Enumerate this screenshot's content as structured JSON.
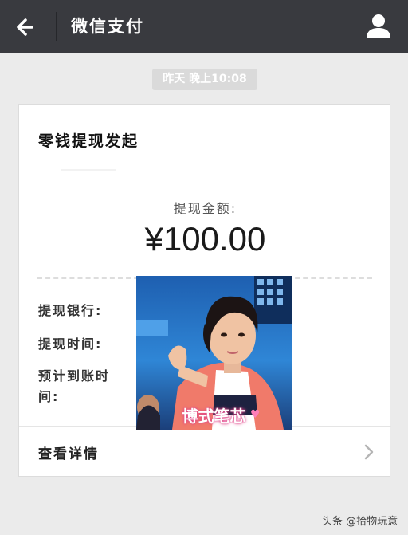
{
  "header": {
    "title": "微信支付",
    "back_icon": "back-arrow-icon",
    "profile_icon": "person-icon"
  },
  "timestamp": "昨天 晚上10:08",
  "card": {
    "title": "零钱提现发起",
    "amount_label": "提现金额:",
    "amount_value": "¥100.00",
    "rows": {
      "bank_label": "提现银行:",
      "time_label": "提现时间:",
      "eta_label": "预计到账时间:"
    },
    "details_label": "查看详情",
    "details_icon": "chevron-right-icon"
  },
  "overlay": {
    "caption": "博式笔芯"
  },
  "watermark": "头条 @拾物玩意",
  "colors": {
    "header_bg": "#393a3f",
    "page_bg": "#ebebeb",
    "card_bg": "#ffffff"
  }
}
